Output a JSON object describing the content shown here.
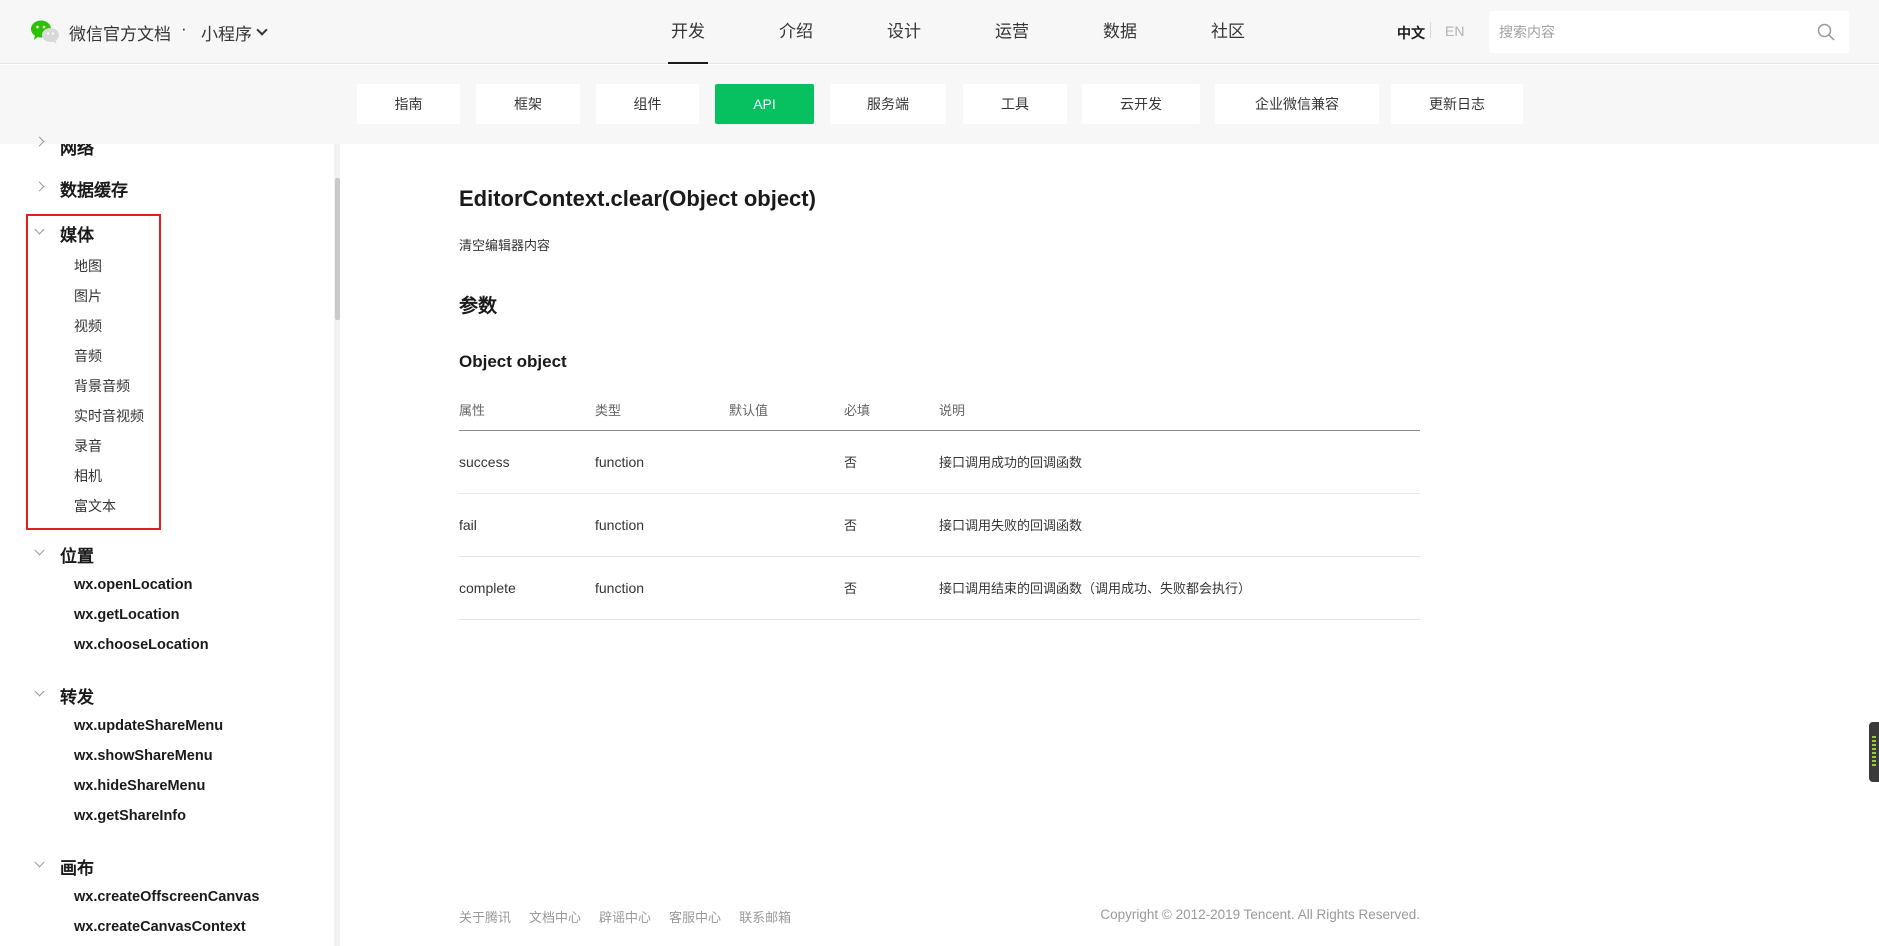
{
  "header": {
    "brand": "微信官方文档",
    "dot": "·",
    "product": "小程序",
    "nav": [
      "开发",
      "介绍",
      "设计",
      "运营",
      "数据",
      "社区"
    ],
    "nav_active": "开发",
    "lang_zh": "中文",
    "lang_en": "EN",
    "search_placeholder": "搜索内容"
  },
  "subnav": {
    "tabs": [
      "指南",
      "框架",
      "组件",
      "API",
      "服务端",
      "工具",
      "云开发",
      "企业微信兼容",
      "更新日志"
    ],
    "active": "API",
    "accent_color": "#07c160"
  },
  "sidebar": {
    "partial_top": "网络",
    "storage": "数据缓存",
    "media": {
      "label": "媒体",
      "items": [
        "地图",
        "图片",
        "视频",
        "音频",
        "背景音频",
        "实时音视频",
        "录音",
        "相机",
        "富文本"
      ]
    },
    "location": {
      "label": "位置",
      "items": [
        "wx.openLocation",
        "wx.getLocation",
        "wx.chooseLocation"
      ]
    },
    "share": {
      "label": "转发",
      "items": [
        "wx.updateShareMenu",
        "wx.showShareMenu",
        "wx.hideShareMenu",
        "wx.getShareInfo"
      ]
    },
    "canvas": {
      "label": "画布",
      "items": [
        "wx.createOffscreenCanvas",
        "wx.createCanvasContext"
      ]
    },
    "highlight_color": "#e02020"
  },
  "content": {
    "title": "EditorContext.clear(Object object)",
    "description": "清空编辑器内容",
    "params_heading": "参数",
    "object_heading": "Object object",
    "table": {
      "headers": [
        "属性",
        "类型",
        "默认值",
        "必填",
        "说明"
      ],
      "rows": [
        [
          "success",
          "function",
          "",
          "否",
          "接口调用成功的回调函数"
        ],
        [
          "fail",
          "function",
          "",
          "否",
          "接口调用失败的回调函数"
        ],
        [
          "complete",
          "function",
          "",
          "否",
          "接口调用结束的回调函数（调用成功、失败都会执行）"
        ]
      ]
    }
  },
  "footer": {
    "links": [
      "关于腾讯",
      "文档中心",
      "辟谣中心",
      "客服中心",
      "联系邮箱"
    ],
    "copyright": "Copyright © 2012-2019 Tencent. All Rights Reserved."
  }
}
